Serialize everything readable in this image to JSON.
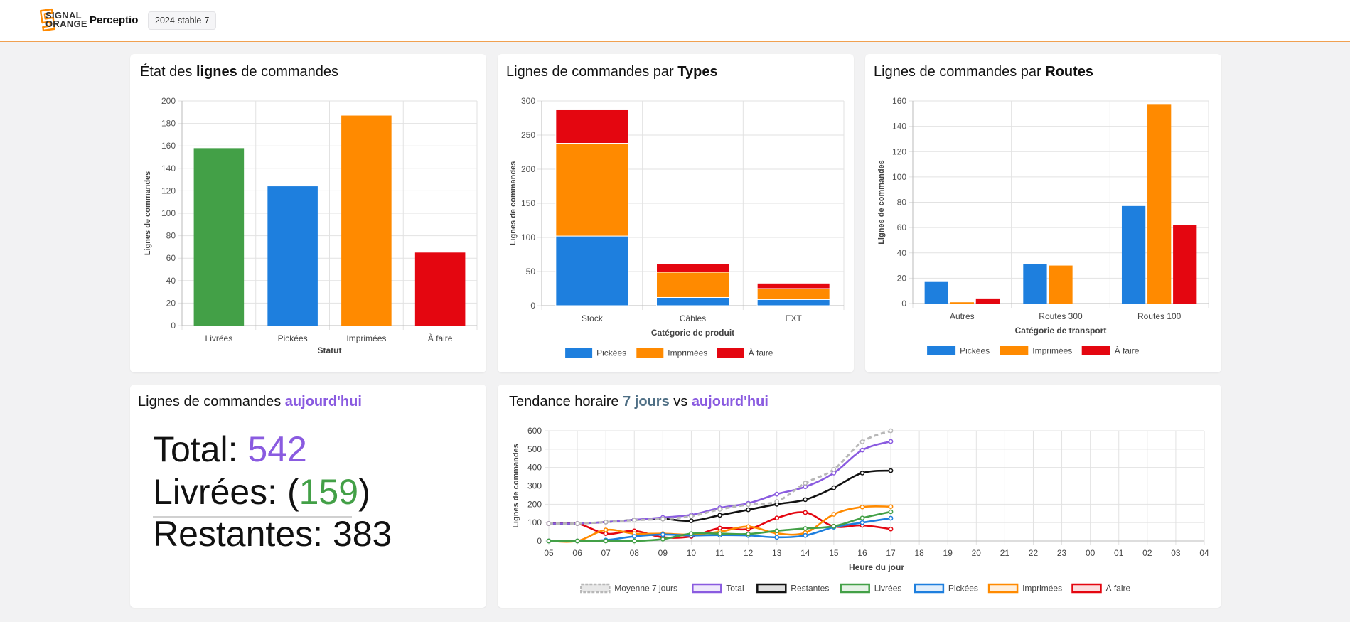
{
  "header": {
    "logo_line1": "SIGNAL",
    "logo_line2": "ORANGE",
    "app_name": "Perceptio",
    "version_badge": "2024-stable-7"
  },
  "colors": {
    "green": "#43a047",
    "blue": "#1e7fde",
    "orange": "#ff8a00",
    "red": "#e40610",
    "purple": "#8a5be0",
    "black": "#111111",
    "avg_gray": "#b8b8b8"
  },
  "cards": {
    "status": {
      "title_pre": "État des ",
      "title_bold": "lignes",
      "title_post": " de commandes"
    },
    "types": {
      "title_pre": "Lignes de commandes par ",
      "title_bold": "Types"
    },
    "routes": {
      "title_pre": "Lignes de commandes par ",
      "title_bold": "Routes"
    },
    "today": {
      "title_pre": "Lignes de commandes ",
      "title_accent": "aujourd'hui",
      "total_label": "Total: ",
      "total_value": "542",
      "delivered_label": "Livrées: (",
      "delivered_value": "159",
      "delivered_close": ")",
      "remaining_label": "Restantes: ",
      "remaining_value": "383"
    },
    "trend": {
      "title_pre": "Tendance horaire ",
      "title_accent1": "7 jours",
      "title_mid": " vs ",
      "title_accent2": "aujourd'hui"
    }
  },
  "chart_data": [
    {
      "id": "status",
      "type": "bar",
      "categories": [
        "Livrées",
        "Pickées",
        "Imprimées",
        "À faire"
      ],
      "values": [
        158,
        124,
        187,
        65
      ],
      "bar_colors": [
        "#43a047",
        "#1e7fde",
        "#ff8a00",
        "#e40610"
      ],
      "xlabel": "Statut",
      "ylabel": "Lignes de commandes",
      "ylim": [
        0,
        200
      ],
      "yticks": [
        0,
        20,
        40,
        60,
        80,
        100,
        120,
        140,
        160,
        180,
        200
      ],
      "grid": true
    },
    {
      "id": "types",
      "type": "bar",
      "stacked": true,
      "categories": [
        "Stock",
        "Câbles",
        "EXT"
      ],
      "series": [
        {
          "name": "Pickées",
          "values": [
            102,
            12,
            9
          ],
          "color": "#1e7fde"
        },
        {
          "name": "Imprimées",
          "values": [
            136,
            37,
            16
          ],
          "color": "#ff8a00"
        },
        {
          "name": "À faire",
          "values": [
            49,
            12,
            8
          ],
          "color": "#e40610"
        }
      ],
      "xlabel": "Catégorie de produit",
      "ylabel": "Lignes de commandes",
      "ylim": [
        0,
        300
      ],
      "yticks": [
        0,
        50,
        100,
        150,
        200,
        250,
        300
      ],
      "legend": "bottom",
      "grid": true
    },
    {
      "id": "routes",
      "type": "bar",
      "categories": [
        "Autres",
        "Routes 300",
        "Routes 100"
      ],
      "series": [
        {
          "name": "Pickées",
          "values": [
            17,
            31,
            77
          ],
          "color": "#1e7fde"
        },
        {
          "name": "Imprimées",
          "values": [
            1,
            30,
            157
          ],
          "color": "#ff8a00"
        },
        {
          "name": "À faire",
          "values": [
            4,
            0,
            62
          ],
          "color": "#e40610"
        }
      ],
      "xlabel": "Catégorie de transport",
      "ylabel": "Lignes de commandes",
      "ylim": [
        0,
        160
      ],
      "yticks": [
        0,
        20,
        40,
        60,
        80,
        100,
        120,
        140,
        160
      ],
      "legend": "bottom",
      "grid": true
    },
    {
      "id": "trend",
      "type": "line",
      "x": [
        "05",
        "06",
        "07",
        "08",
        "09",
        "10",
        "11",
        "12",
        "13",
        "14",
        "15",
        "16",
        "17",
        "18",
        "19",
        "20",
        "21",
        "22",
        "23",
        "00",
        "01",
        "02",
        "03",
        "04"
      ],
      "series": [
        {
          "name": "Moyenne 7 jours",
          "color": "#b8b8b8",
          "dashed": true,
          "values": [
            95,
            95,
            103,
            113,
            120,
            135,
            172,
            198,
            215,
            315,
            390,
            540,
            600
          ]
        },
        {
          "name": "Total",
          "color": "#8a5be0",
          "values": [
            95,
            95,
            103,
            115,
            128,
            142,
            180,
            205,
            255,
            295,
            370,
            495,
            542
          ]
        },
        {
          "name": "Restantes",
          "color": "#111111",
          "values": [
            95,
            95,
            103,
            115,
            120,
            110,
            140,
            170,
            200,
            225,
            290,
            370,
            383
          ]
        },
        {
          "name": "Livrées",
          "color": "#43a047",
          "values": [
            0,
            0,
            0,
            0,
            10,
            40,
            40,
            38,
            55,
            68,
            80,
            125,
            159
          ]
        },
        {
          "name": "Pickées",
          "color": "#1e7fde",
          "values": [
            0,
            0,
            5,
            25,
            35,
            30,
            32,
            30,
            20,
            30,
            75,
            100,
            124
          ]
        },
        {
          "name": "Imprimées",
          "color": "#ff8a00",
          "values": [
            0,
            0,
            60,
            40,
            40,
            35,
            50,
            78,
            42,
            45,
            145,
            185,
            187
          ]
        },
        {
          "name": "À faire",
          "color": "#e40610",
          "values": [
            95,
            95,
            40,
            55,
            20,
            25,
            70,
            65,
            125,
            155,
            80,
            85,
            65
          ]
        }
      ],
      "xlabel": "Heure du jour",
      "ylabel": "Lignes de commandes",
      "ylim": [
        0,
        600
      ],
      "yticks": [
        0,
        100,
        200,
        300,
        400,
        500,
        600
      ],
      "legend": "bottom",
      "grid": true
    }
  ]
}
